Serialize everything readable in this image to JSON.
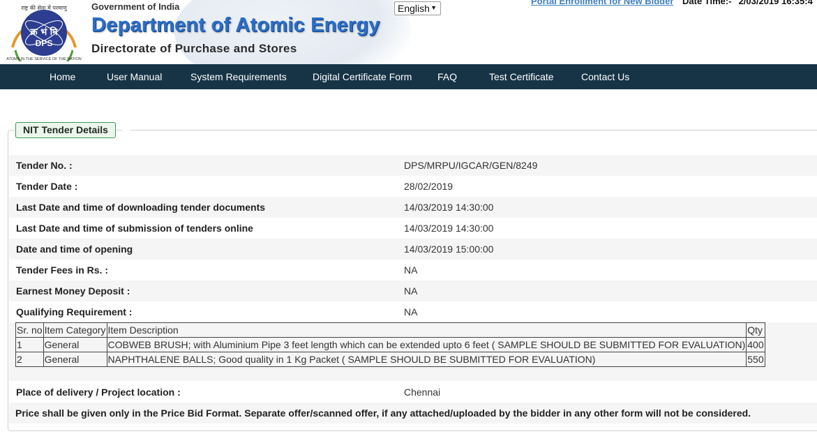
{
  "header": {
    "logo_top_text": "राष्ट्र की सेवा में परमाणु",
    "logo_hindi": "क्र भं नि",
    "logo_abbr": "DPS",
    "logo_ring_text": "ATOMS IN THE SERVICE OF THE NATION",
    "gov_text": "Government of India",
    "dept_name": "Department of Atomic Energy",
    "directorate": "Directorate of Purchase and Stores",
    "language_selected": "English",
    "portal_link": "Portal Enrollment for New Bidder",
    "datetime_label": "Date Time:-",
    "datetime_value": "2/03/2019 16:35:4"
  },
  "nav": {
    "items": [
      {
        "label": "Home"
      },
      {
        "label": "User Manual"
      },
      {
        "label": "System Requirements"
      },
      {
        "label": "Digital Certificate Form"
      },
      {
        "label": "FAQ"
      },
      {
        "label": "Test Certificate"
      },
      {
        "label": "Contact Us"
      }
    ]
  },
  "panel": {
    "title": "NIT Tender Details",
    "fields": [
      {
        "label": "Tender No. :",
        "value": "DPS/MRPU/IGCAR/GEN/8249"
      },
      {
        "label": "Tender Date :",
        "value": "28/02/2019"
      },
      {
        "label": "Last Date and time of downloading tender documents",
        "value": "14/03/2019 14:30:00"
      },
      {
        "label": "Last Date and time of submission of tenders online",
        "value": "14/03/2019 14:30:00"
      },
      {
        "label": "Date and time of opening",
        "value": "14/03/2019 15:00:00"
      },
      {
        "label": "Tender Fees in Rs. :",
        "value": "NA"
      },
      {
        "label": "Earnest Money Deposit :",
        "value": "NA"
      },
      {
        "label": "Qualifying Requirement :",
        "value": "NA"
      }
    ],
    "items_table": {
      "headers": [
        "Sr. no",
        "Item Category",
        "Item Description",
        "Qty"
      ],
      "rows": [
        [
          "1",
          "General",
          "COBWEB BRUSH; with Aluminium Pipe 3 feet length which can be extended upto 6 feet ( SAMPLE SHOULD BE SUBMITTED FOR EVALUATION)",
          "400"
        ],
        [
          "2",
          "General",
          "NAPHTHALENE BALLS; Good quality in 1 Kg Packet ( SAMPLE SHOULD BE SUBMITTED FOR EVALUATION)",
          "550"
        ]
      ]
    },
    "delivery": {
      "label": "Place of delivery / Project location :",
      "value": "Chennai"
    },
    "note": "Price shall be given only in the Price Bid Format. Separate offer/scanned offer, if any attached/uploaded by the bidder in any other form will not be considered."
  },
  "colors": {
    "nav_bg": "#173447",
    "dept_blue": "#2a6fc9",
    "legend_border": "#3f9a52",
    "portal_link": "#3e7fbf"
  }
}
